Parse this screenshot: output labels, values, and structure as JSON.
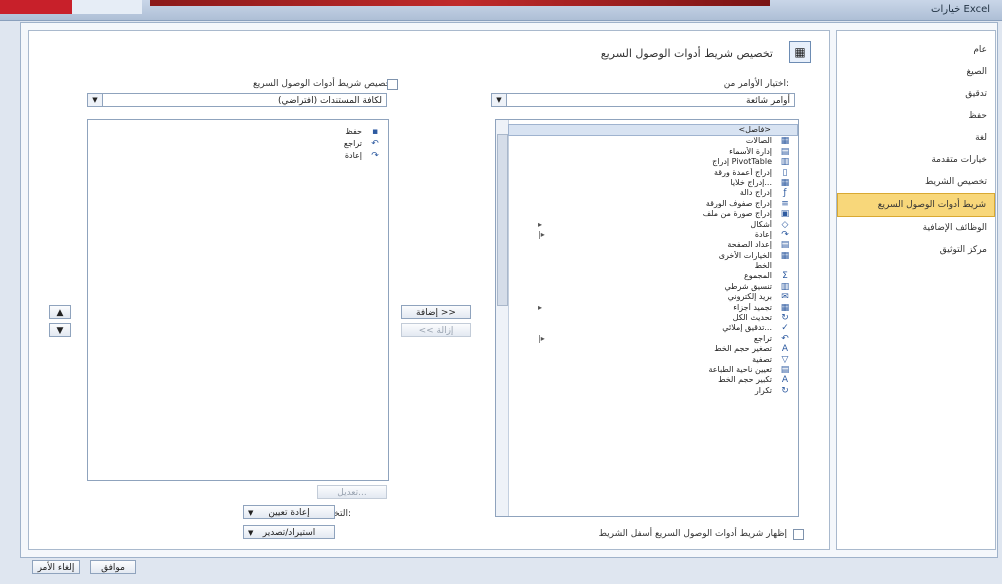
{
  "window": {
    "title": "خيارات Excel"
  },
  "nav": {
    "items": [
      "عام",
      "الصيغ",
      "تدقيق",
      "حفظ",
      "لغة",
      "خيارات متقدمة",
      "تخصيص الشريط",
      "شريط أدوات الوصول السريع",
      "الوظائف الإضافية",
      "مركز التوثيق"
    ],
    "selected_index": 7
  },
  "header": {
    "title": "تخصيص شريط أدوات الوصول السريع",
    "icon": "quick-access-icon"
  },
  "left_panel": {
    "choose_label": "اختيار الأوامر من:",
    "choose_value": "أوامر شائعة",
    "commands": [
      {
        "label": "<فاصل>",
        "icon": "",
        "flag": ""
      },
      {
        "label": "الصالات",
        "icon": "▦",
        "flag": ""
      },
      {
        "label": "إدارة الأسماء",
        "icon": "▤",
        "flag": ""
      },
      {
        "label": "إدراج PivotTable",
        "icon": "▥",
        "flag": ""
      },
      {
        "label": "إدراج أعمدة ورقة",
        "icon": "▯",
        "flag": ""
      },
      {
        "label": "إدراج خلايا...",
        "icon": "▦",
        "flag": ""
      },
      {
        "label": "إدراج دالة",
        "icon": "ƒ",
        "flag": ""
      },
      {
        "label": "إدراج صفوف الورقة",
        "icon": "≡",
        "flag": ""
      },
      {
        "label": "إدراج صورة من ملف",
        "icon": "▣",
        "flag": ""
      },
      {
        "label": "أشكال",
        "icon": "◇",
        "flag": "▸"
      },
      {
        "label": "إعادة",
        "icon": "↷",
        "flag": "|▸"
      },
      {
        "label": "إعداد الصفحة",
        "icon": "▤",
        "flag": ""
      },
      {
        "label": "الخيارات الأخرى",
        "icon": "▦",
        "flag": ""
      },
      {
        "label": "الخط",
        "icon": "",
        "flag": ""
      },
      {
        "label": "المجموع",
        "icon": "Σ",
        "flag": ""
      },
      {
        "label": "تنسيق شرطي",
        "icon": "▥",
        "flag": ""
      },
      {
        "label": "بريد إلكتروني",
        "icon": "✉",
        "flag": ""
      },
      {
        "label": "تجميد أجزاء",
        "icon": "▦",
        "flag": "▸"
      },
      {
        "label": "تحديث الكل",
        "icon": "↻",
        "flag": ""
      },
      {
        "label": "تدقيق إملائي...",
        "icon": "✓",
        "flag": ""
      },
      {
        "label": "تراجع",
        "icon": "↶",
        "flag": "|▸"
      },
      {
        "label": "تصغير حجم الخط",
        "icon": "A",
        "flag": ""
      },
      {
        "label": "تصفية",
        "icon": "▽",
        "flag": ""
      },
      {
        "label": "تعيين ناحية الطباعة",
        "icon": "▤",
        "flag": ""
      },
      {
        "label": "تكبير حجم الخط",
        "icon": "A",
        "flag": ""
      },
      {
        "label": "تكرار",
        "icon": "↻",
        "flag": ""
      }
    ],
    "show_below_label": "إظهار شريط أدوات الوصول السريع أسفل الشريط"
  },
  "right_panel": {
    "customize_label": "تخصيص شريط أدوات الوصول السريع:",
    "customize_value": "لكافة المستندات (افتراضي)",
    "items": [
      {
        "label": "حفظ",
        "icon": "▪"
      },
      {
        "label": "تراجع",
        "icon": "↶"
      },
      {
        "label": "إعادة",
        "icon": "↷"
      }
    ],
    "modify_label": "تعديل...",
    "customizations_label": "التخصيصات:",
    "reset_label": "إعادة تعيين",
    "import_export_label": "استيراد/تصدير"
  },
  "middle": {
    "add_label": "إضافة >>",
    "remove_label": "<< إزالة"
  },
  "footer": {
    "ok_label": "موافق",
    "cancel_label": "إلغاء الأمر"
  }
}
